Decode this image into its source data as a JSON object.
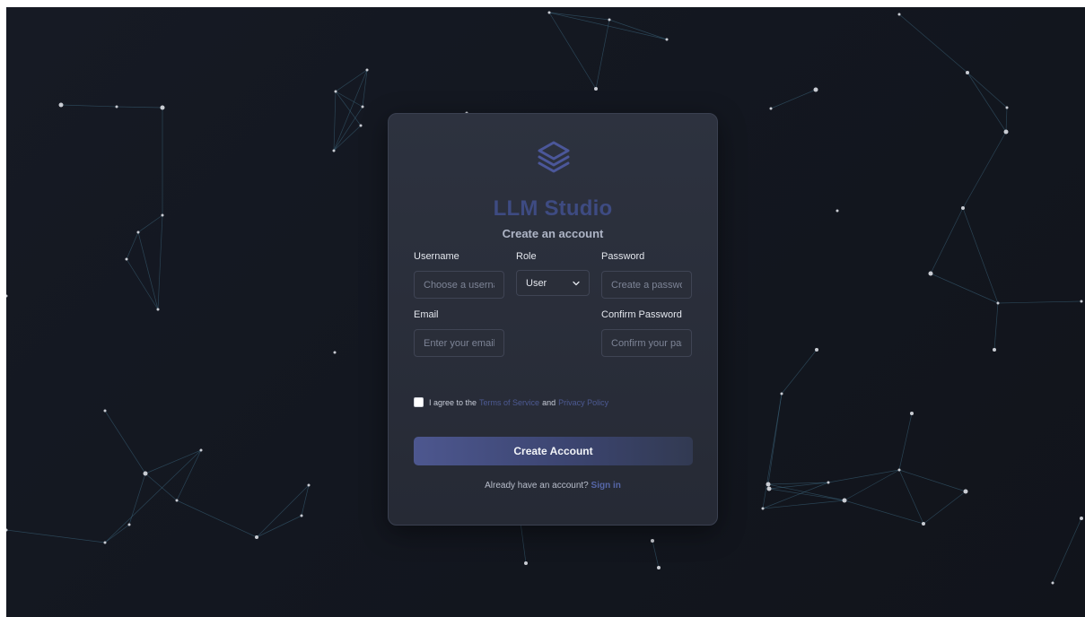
{
  "brand": {
    "name": "LLM Studio",
    "logo_icon": "stacked-layers-icon",
    "accent_color": "#4d5a93"
  },
  "form": {
    "heading": "Create an account",
    "username": {
      "label": "Username",
      "placeholder": "Choose a username",
      "value": ""
    },
    "role": {
      "label": "Role",
      "selected": "User"
    },
    "password": {
      "label": "Password",
      "placeholder": "Create a password",
      "value": ""
    },
    "email": {
      "label": "Email",
      "placeholder": "Enter your email",
      "value": ""
    },
    "confirm_password": {
      "label": "Confirm Password",
      "placeholder": "Confirm your password",
      "value": ""
    },
    "terms": {
      "prefix": "I agree to the",
      "tos_link": "Terms of Service",
      "middle": "and",
      "privacy_link": "Privacy Policy",
      "checked": false
    },
    "submit_label": "Create Account",
    "signin_prompt": "Already have an account?",
    "signin_link": "Sign in"
  },
  "colors": {
    "background": "#131720",
    "card": "#2a2e3a",
    "button_start": "#4d578f",
    "button_end": "#323a52",
    "network_node": "#c9ccd3",
    "network_edge": "#3e6a82"
  }
}
